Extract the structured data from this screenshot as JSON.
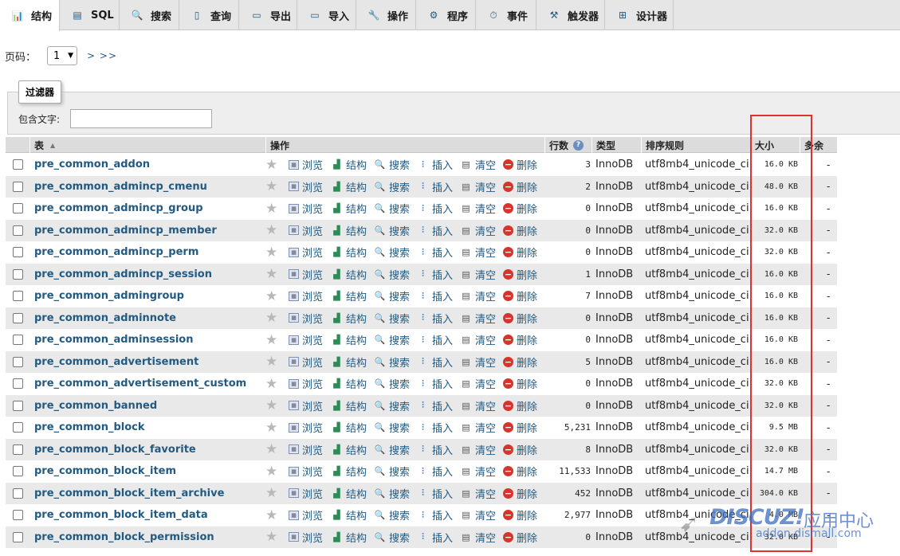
{
  "tabs": [
    {
      "label": "结构",
      "icon": "structure-icon",
      "glyph": "📊",
      "active": true
    },
    {
      "label": "SQL",
      "icon": "sql-icon",
      "glyph": "▤",
      "active": false
    },
    {
      "label": "搜索",
      "icon": "search-icon",
      "glyph": "🔍",
      "active": false
    },
    {
      "label": "查询",
      "icon": "query-icon",
      "glyph": "▯",
      "active": false
    },
    {
      "label": "导出",
      "icon": "export-icon",
      "glyph": "▭",
      "active": false
    },
    {
      "label": "导入",
      "icon": "import-icon",
      "glyph": "▭",
      "active": false
    },
    {
      "label": "操作",
      "icon": "wrench-icon",
      "glyph": "🔧",
      "active": false
    },
    {
      "label": "程序",
      "icon": "routines-icon",
      "glyph": "⚙",
      "active": false
    },
    {
      "label": "事件",
      "icon": "clock-icon",
      "glyph": "⏱",
      "active": false
    },
    {
      "label": "触发器",
      "icon": "trigger-icon",
      "glyph": "⚒",
      "active": false
    },
    {
      "label": "设计器",
      "icon": "designer-icon",
      "glyph": "⊞",
      "active": false
    }
  ],
  "pager": {
    "label": "页码：",
    "selected": "1",
    "next": "> >>"
  },
  "filter": {
    "legend": "过滤器",
    "label": "包含文字:",
    "value": ""
  },
  "columns": {
    "table": "表",
    "action": "操作",
    "rows": "行数",
    "type": "类型",
    "collation": "排序规则",
    "size": "大小",
    "overhead": "多余"
  },
  "actions": {
    "browse": "浏览",
    "structure": "结构",
    "search": "搜索",
    "insert": "插入",
    "empty": "清空",
    "drop": "删除"
  },
  "tables": [
    {
      "name": "pre_common_addon",
      "rows": "3",
      "engine": "InnoDB",
      "collation": "utf8mb4_unicode_ci",
      "size": "16.0 KB",
      "overhead": "-"
    },
    {
      "name": "pre_common_admincp_cmenu",
      "rows": "2",
      "engine": "InnoDB",
      "collation": "utf8mb4_unicode_ci",
      "size": "48.0 KB",
      "overhead": "-"
    },
    {
      "name": "pre_common_admincp_group",
      "rows": "0",
      "engine": "InnoDB",
      "collation": "utf8mb4_unicode_ci",
      "size": "16.0 KB",
      "overhead": "-"
    },
    {
      "name": "pre_common_admincp_member",
      "rows": "0",
      "engine": "InnoDB",
      "collation": "utf8mb4_unicode_ci",
      "size": "32.0 KB",
      "overhead": "-"
    },
    {
      "name": "pre_common_admincp_perm",
      "rows": "0",
      "engine": "InnoDB",
      "collation": "utf8mb4_unicode_ci",
      "size": "32.0 KB",
      "overhead": "-"
    },
    {
      "name": "pre_common_admincp_session",
      "rows": "1",
      "engine": "InnoDB",
      "collation": "utf8mb4_unicode_ci",
      "size": "16.0 KB",
      "overhead": "-"
    },
    {
      "name": "pre_common_admingroup",
      "rows": "7",
      "engine": "InnoDB",
      "collation": "utf8mb4_unicode_ci",
      "size": "16.0 KB",
      "overhead": "-"
    },
    {
      "name": "pre_common_adminnote",
      "rows": "0",
      "engine": "InnoDB",
      "collation": "utf8mb4_unicode_ci",
      "size": "16.0 KB",
      "overhead": "-"
    },
    {
      "name": "pre_common_adminsession",
      "rows": "0",
      "engine": "InnoDB",
      "collation": "utf8mb4_unicode_ci",
      "size": "16.0 KB",
      "overhead": "-"
    },
    {
      "name": "pre_common_advertisement",
      "rows": "5",
      "engine": "InnoDB",
      "collation": "utf8mb4_unicode_ci",
      "size": "16.0 KB",
      "overhead": "-"
    },
    {
      "name": "pre_common_advertisement_custom",
      "rows": "0",
      "engine": "InnoDB",
      "collation": "utf8mb4_unicode_ci",
      "size": "32.0 KB",
      "overhead": "-"
    },
    {
      "name": "pre_common_banned",
      "rows": "0",
      "engine": "InnoDB",
      "collation": "utf8mb4_unicode_ci",
      "size": "32.0 KB",
      "overhead": "-"
    },
    {
      "name": "pre_common_block",
      "rows": "5,231",
      "engine": "InnoDB",
      "collation": "utf8mb4_unicode_ci",
      "size": "9.5 MB",
      "overhead": "-"
    },
    {
      "name": "pre_common_block_favorite",
      "rows": "8",
      "engine": "InnoDB",
      "collation": "utf8mb4_unicode_ci",
      "size": "32.0 KB",
      "overhead": "-"
    },
    {
      "name": "pre_common_block_item",
      "rows": "11,533",
      "engine": "InnoDB",
      "collation": "utf8mb4_unicode_ci",
      "size": "14.7 MB",
      "overhead": "-"
    },
    {
      "name": "pre_common_block_item_archive",
      "rows": "452",
      "engine": "InnoDB",
      "collation": "utf8mb4_unicode_ci",
      "size": "304.0 KB",
      "overhead": "-"
    },
    {
      "name": "pre_common_block_item_data",
      "rows": "2,977",
      "engine": "InnoDB",
      "collation": "utf8mb4_unicode_ci",
      "size": "4.0 MB",
      "overhead": "-"
    },
    {
      "name": "pre_common_block_permission",
      "rows": "0",
      "engine": "InnoDB",
      "collation": "utf8mb4_unicode_ci",
      "size": "32.0 KB",
      "overhead": "-"
    }
  ],
  "watermark": {
    "brand": "DISCUZ!",
    "cn": "应用中心",
    "url": "addon.dismall.com"
  },
  "colors": {
    "link": "#235a81",
    "highlight": "#e03131",
    "row_alt": "#e9e9e9"
  }
}
